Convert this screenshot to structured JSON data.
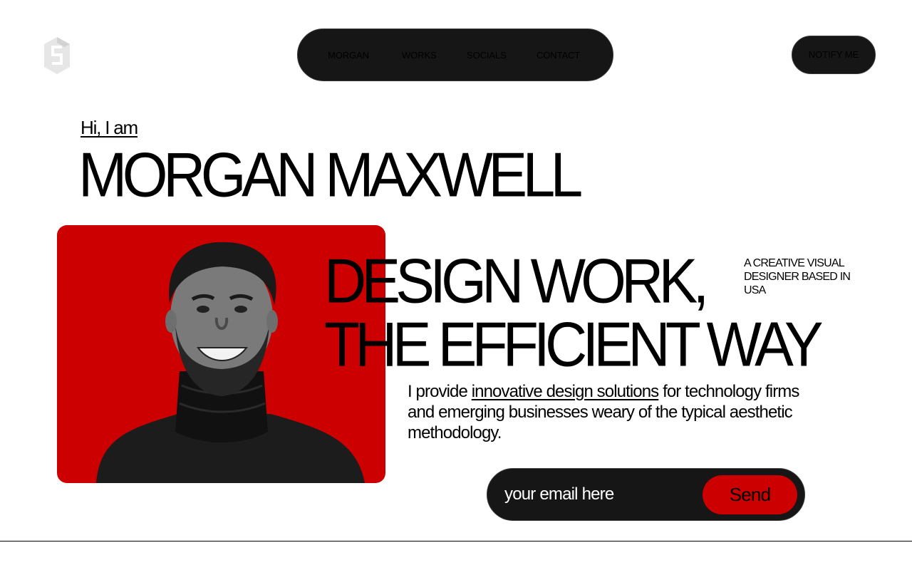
{
  "header": {
    "nav": [
      "MORGAN",
      "WORKS",
      "SOCIALS",
      "CONTACT"
    ],
    "notify_label": "NOTIFY ME"
  },
  "hero": {
    "greeting": "Hi, I am",
    "name": "MORGAN MAXWELL",
    "headline_line1": "DESIGN WORK,",
    "headline_line2": "THE EFFICIENT WAY",
    "tagline": "A CREATIVE VISUAL DESIGNER BASED IN USA",
    "intro_before": "I provide ",
    "intro_link": "innovative design solutions",
    "intro_after": " for technology firms and emerging businesses weary of the typical aesthetic methodology."
  },
  "email_form": {
    "placeholder": "your email here",
    "send_label": "Send"
  },
  "icons": {
    "logo": "hexagon-s-logo-icon"
  },
  "colors": {
    "accent": "#cc0000",
    "dark": "#161616",
    "background": "#ffffff"
  }
}
